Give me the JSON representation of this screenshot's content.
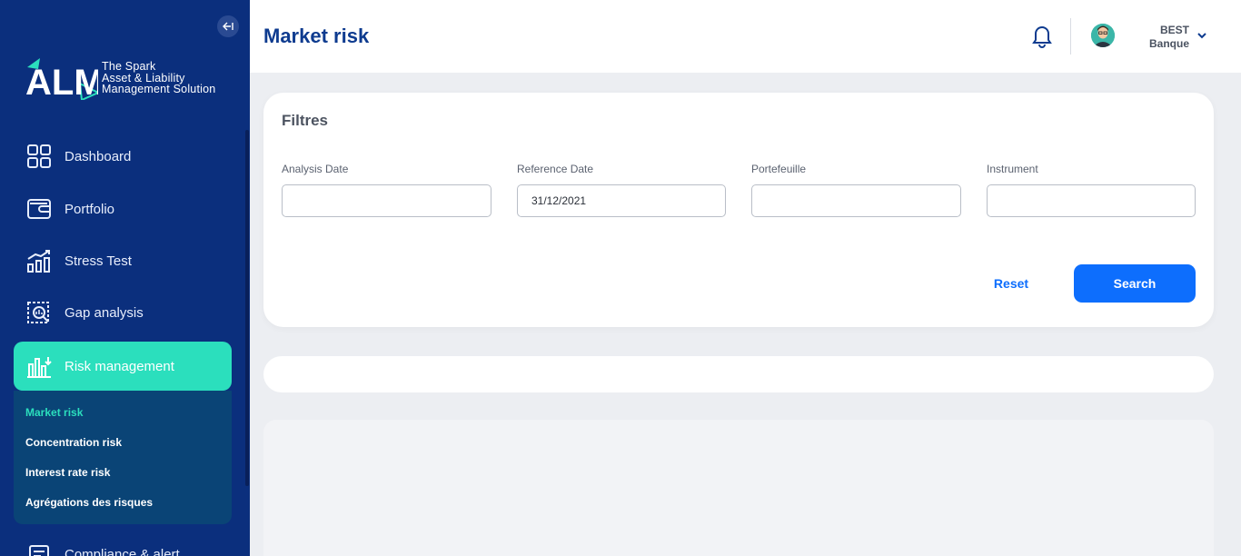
{
  "logo": {
    "mark": "ALM",
    "tagline_1": "The Spark",
    "tagline_2": "Asset & Liability",
    "tagline_3": "Management Solution"
  },
  "sidebar": {
    "items": [
      {
        "label": "Dashboard",
        "icon": "dashboard-grid-icon"
      },
      {
        "label": "Portfolio",
        "icon": "wallet-icon"
      },
      {
        "label": "Stress Test",
        "icon": "chart-trend-icon"
      },
      {
        "label": "Gap analysis",
        "icon": "magnifier-chart-icon"
      },
      {
        "label": "Risk management",
        "icon": "bar-chart-icon",
        "active": true
      },
      {
        "label": "Compliance & alert",
        "icon": "compliance-icon"
      }
    ],
    "submenu": [
      {
        "label": "Market risk",
        "active": true
      },
      {
        "label": "Concentration risk"
      },
      {
        "label": "Interest rate risk"
      },
      {
        "label": "Agrégations des risques"
      }
    ]
  },
  "header": {
    "title": "Market risk",
    "user_line1": "BEST",
    "user_line2": "Banque"
  },
  "filters": {
    "title": "Filtres",
    "fields": [
      {
        "label": "Analysis Date",
        "value": ""
      },
      {
        "label": "Reference Date",
        "value": "31/12/2021"
      },
      {
        "label": "Portefeuille",
        "value": ""
      },
      {
        "label": "Instrument",
        "value": ""
      }
    ],
    "reset_label": "Reset",
    "search_label": "Search"
  },
  "colors": {
    "sidebar_bg": "#0b2f7d",
    "active_accent": "#2bdfbd",
    "submenu_bg": "#0a4476",
    "primary_button": "#0d6efd",
    "title_color": "#0e3b8f"
  }
}
